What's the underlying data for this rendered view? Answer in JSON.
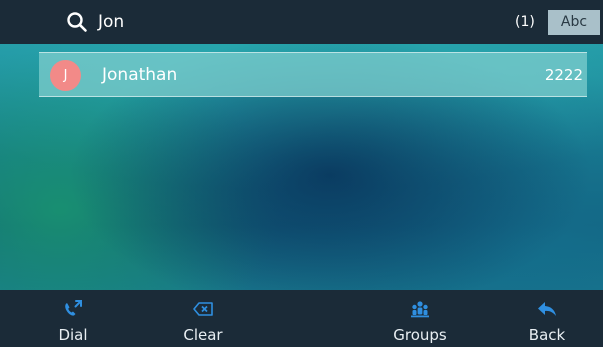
{
  "search": {
    "query": "Jon",
    "result_count": "(1)",
    "input_mode": "Abc"
  },
  "results": [
    {
      "initial": "J",
      "name": "Jonathan",
      "number": "2222",
      "avatar_color": "#f28a88"
    }
  ],
  "softkeys": {
    "dial": {
      "label": "Dial",
      "icon": "phone-icon"
    },
    "clear": {
      "label": "Clear",
      "icon": "backspace-icon"
    },
    "groups": {
      "label": "Groups",
      "icon": "groups-icon"
    },
    "back": {
      "label": "Back",
      "icon": "back-arrow-icon"
    }
  },
  "colors": {
    "bar_background": "#1b2b38",
    "selected_row": "#7dcdcd",
    "icon_blue": "#2f8fe0",
    "mode_badge": "#a9c0c9"
  }
}
